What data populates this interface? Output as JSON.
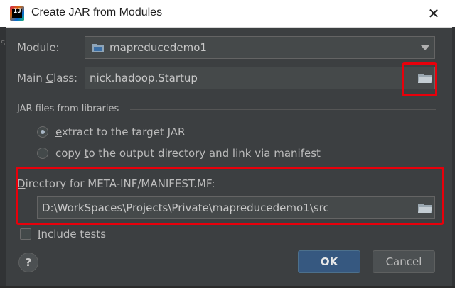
{
  "window": {
    "title": "Create JAR from Modules",
    "close_glyph": "✕",
    "app_icon": "intellij-idea-icon",
    "app_icon_letters": "IJ"
  },
  "background_fragment": "S",
  "module": {
    "label_mnemonic": "M",
    "label_rest": "odule:",
    "value": "mapreducedemo1",
    "icon": "folder-module-icon"
  },
  "main_class": {
    "label_before": "Main ",
    "label_mnemonic": "C",
    "label_after": "lass:",
    "value": "nick.hadoop.Startup",
    "browse_icon": "folder-browse-icon"
  },
  "jar_section": {
    "title": "JAR files from libraries",
    "options": [
      {
        "label_before": "",
        "mnemonic": "e",
        "label_after": "xtract to the target JAR",
        "selected": true
      },
      {
        "label_before": "copy ",
        "mnemonic": "t",
        "label_after": "o the output directory and link via manifest",
        "selected": false
      }
    ]
  },
  "manifest": {
    "label_mnemonic": "D",
    "label_rest": "irectory for META-INF/MANIFEST.MF:",
    "value": "D:\\WorkSpaces\\Projects\\Private\\mapreducedemo1\\src",
    "browse_icon": "folder-browse-icon"
  },
  "include_tests": {
    "label_mnemonic": "I",
    "label_rest": "nclude tests",
    "checked": false
  },
  "buttons": {
    "help": "?",
    "ok": "OK",
    "cancel": "Cancel"
  },
  "colors": {
    "dialog_bg": "#3c3f41",
    "field_bg": "#45494a",
    "accent_blue": "#365880",
    "annotation_red": "#e8000b"
  }
}
